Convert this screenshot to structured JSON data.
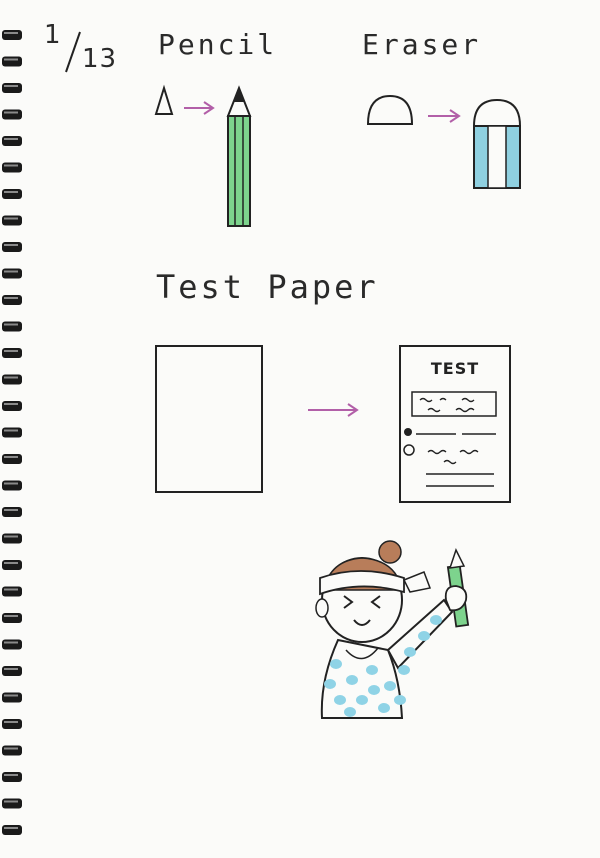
{
  "page_number": {
    "current": "1",
    "total": "13"
  },
  "labels": {
    "pencil": "Pencil",
    "eraser": "Eraser",
    "test_paper": "Test Paper"
  },
  "test_sheet": {
    "heading": "TEST"
  },
  "colors": {
    "pencil_green": "#7dd38d",
    "eraser_blue": "#8fd0e0",
    "arrow": "#b25fa8",
    "hair": "#b87d5a",
    "shirt_dots": "#8fd3e6",
    "ink": "#222222"
  }
}
